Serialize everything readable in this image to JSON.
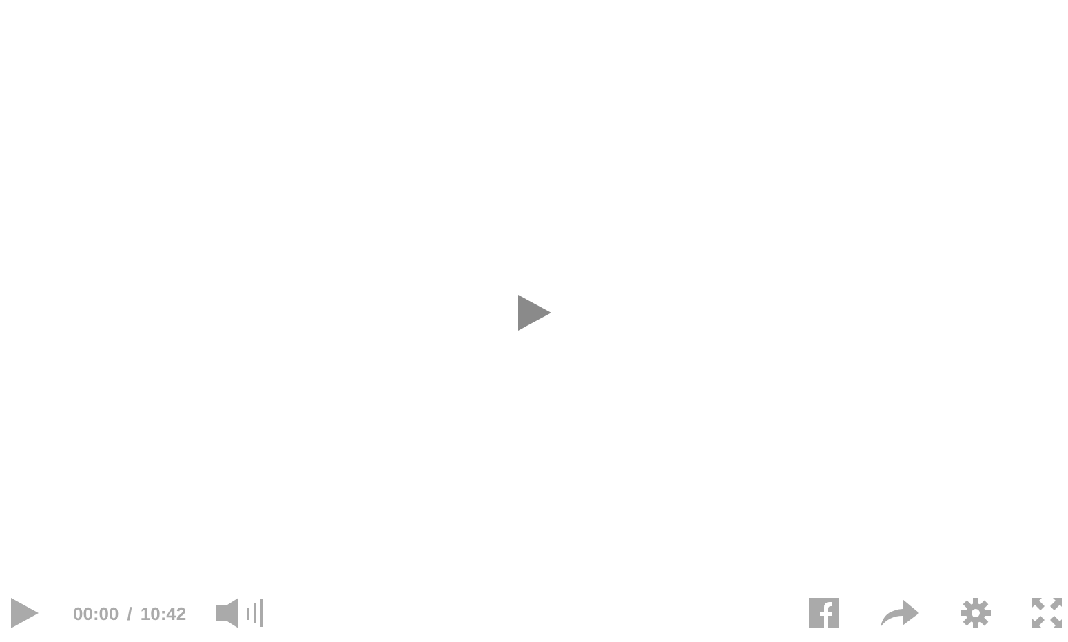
{
  "player": {
    "current_time": "00:00",
    "separator": "/",
    "duration": "10:42"
  }
}
